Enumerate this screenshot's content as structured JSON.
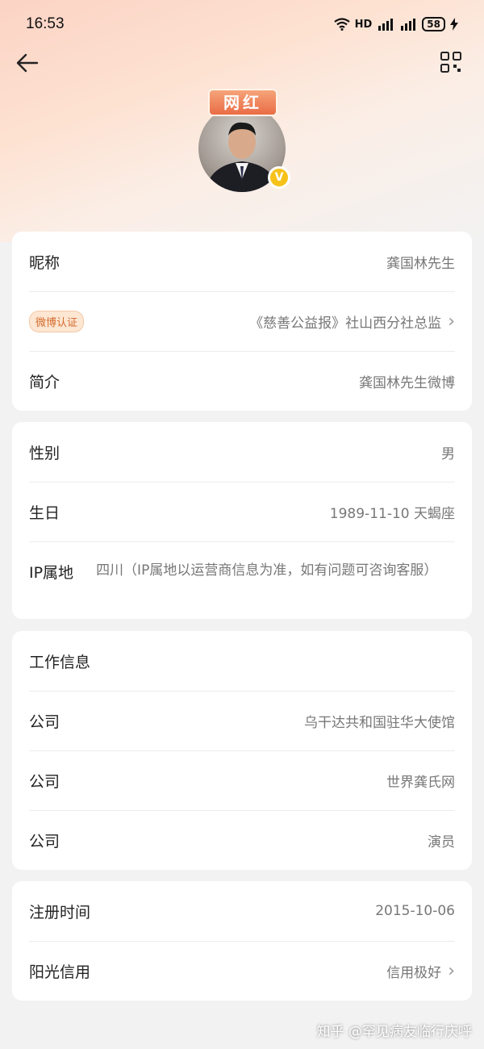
{
  "status_bar": {
    "time": "16:53",
    "network": "HD",
    "battery": "58"
  },
  "header": {
    "avatar_badge": "网红",
    "verified_mark": "V"
  },
  "card1": {
    "nickname_label": "昵称",
    "nickname_value": "龚国林先生",
    "verify_badge": "微博认证",
    "verify_value": "《慈善公益报》社山西分社总监",
    "intro_label": "简介",
    "intro_value": "龚国林先生微博"
  },
  "card2": {
    "gender_label": "性别",
    "gender_value": "男",
    "birthday_label": "生日",
    "birthday_value": "1989-11-10 天蝎座",
    "ip_label": "IP属地",
    "ip_value": "四川（IP属地以运营商信息为准，如有问题可咨询客服）"
  },
  "card3": {
    "title": "工作信息",
    "companies": [
      {
        "label": "公司",
        "value": "乌干达共和国驻华大使馆"
      },
      {
        "label": "公司",
        "value": "世界龚氏网"
      },
      {
        "label": "公司",
        "value": "演员"
      }
    ]
  },
  "card4": {
    "register_label": "注册时间",
    "register_value": "2015-10-06",
    "credit_label": "阳光信用",
    "credit_value": "信用极好"
  },
  "footer": {
    "watermark": "知乎 @罕见病友临行庆呼"
  },
  "colors": {
    "accent": "#f6c21a",
    "badge_bg": "#fde6d2",
    "badge_text": "#d46b2c"
  }
}
